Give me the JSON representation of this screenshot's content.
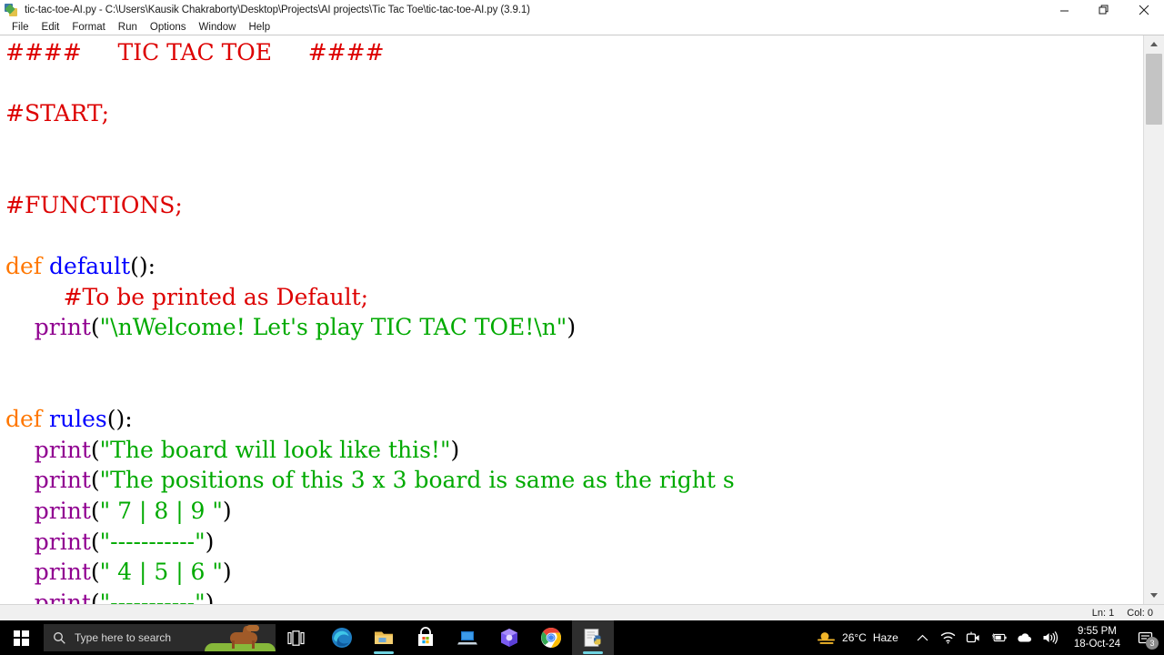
{
  "window": {
    "title": "tic-tac-toe-AI.py - C:\\Users\\Kausik Chakraborty\\Desktop\\Projects\\AI projects\\Tic Tac Toe\\tic-tac-toe-AI.py (3.9.1)",
    "icon": "python-idle-icon",
    "controls": {
      "minimize": "minimize-button",
      "restore": "restore-button",
      "close": "close-button"
    }
  },
  "menubar": {
    "items": [
      {
        "label": "File"
      },
      {
        "label": "Edit"
      },
      {
        "label": "Format"
      },
      {
        "label": "Run"
      },
      {
        "label": "Options"
      },
      {
        "label": "Window"
      },
      {
        "label": "Help"
      }
    ]
  },
  "editor": {
    "language": "python",
    "colors": {
      "comment": "#dd0000",
      "keyword": "#ff7700",
      "definition": "#0000ff",
      "builtin": "#900090",
      "string": "#00aa00",
      "plain": "#000000",
      "background": "#ffffff"
    },
    "lines": [
      {
        "n": 1,
        "tokens": [
          {
            "t": "comment",
            "s": "####     TIC TAC TOE     ####"
          }
        ]
      },
      {
        "n": 2,
        "tokens": []
      },
      {
        "n": 3,
        "tokens": [
          {
            "t": "comment",
            "s": "#START;"
          }
        ]
      },
      {
        "n": 4,
        "tokens": []
      },
      {
        "n": 5,
        "tokens": []
      },
      {
        "n": 6,
        "tokens": [
          {
            "t": "comment",
            "s": "#FUNCTIONS;"
          }
        ]
      },
      {
        "n": 7,
        "tokens": []
      },
      {
        "n": 8,
        "tokens": [
          {
            "t": "keyword",
            "s": "def"
          },
          {
            "t": "plain",
            "s": " "
          },
          {
            "t": "definition",
            "s": "default"
          },
          {
            "t": "plain",
            "s": "():"
          }
        ]
      },
      {
        "n": 9,
        "tokens": [
          {
            "t": "comment",
            "s": "        #To be printed as Default;"
          }
        ]
      },
      {
        "n": 10,
        "tokens": [
          {
            "t": "plain",
            "s": "    "
          },
          {
            "t": "builtin",
            "s": "print"
          },
          {
            "t": "plain",
            "s": "("
          },
          {
            "t": "string",
            "s": "\"\\nWelcome! Let's play TIC TAC TOE!\\n\""
          },
          {
            "t": "plain",
            "s": ")"
          }
        ]
      },
      {
        "n": 11,
        "tokens": []
      },
      {
        "n": 12,
        "tokens": []
      },
      {
        "n": 13,
        "tokens": [
          {
            "t": "keyword",
            "s": "def"
          },
          {
            "t": "plain",
            "s": " "
          },
          {
            "t": "definition",
            "s": "rules"
          },
          {
            "t": "plain",
            "s": "():"
          }
        ]
      },
      {
        "n": 14,
        "tokens": [
          {
            "t": "plain",
            "s": "    "
          },
          {
            "t": "builtin",
            "s": "print"
          },
          {
            "t": "plain",
            "s": "("
          },
          {
            "t": "string",
            "s": "\"The board will look like this!\""
          },
          {
            "t": "plain",
            "s": ")"
          }
        ]
      },
      {
        "n": 15,
        "tokens": [
          {
            "t": "plain",
            "s": "    "
          },
          {
            "t": "builtin",
            "s": "print"
          },
          {
            "t": "plain",
            "s": "("
          },
          {
            "t": "string",
            "s": "\"The positions of this 3 x 3 board is same as the right s"
          }
        ]
      },
      {
        "n": 16,
        "tokens": [
          {
            "t": "plain",
            "s": "    "
          },
          {
            "t": "builtin",
            "s": "print"
          },
          {
            "t": "plain",
            "s": "("
          },
          {
            "t": "string",
            "s": "\" 7 | 8 | 9 \""
          },
          {
            "t": "plain",
            "s": ")"
          }
        ]
      },
      {
        "n": 17,
        "tokens": [
          {
            "t": "plain",
            "s": "    "
          },
          {
            "t": "builtin",
            "s": "print"
          },
          {
            "t": "plain",
            "s": "("
          },
          {
            "t": "string",
            "s": "\"-----------\""
          },
          {
            "t": "plain",
            "s": ")"
          }
        ]
      },
      {
        "n": 18,
        "tokens": [
          {
            "t": "plain",
            "s": "    "
          },
          {
            "t": "builtin",
            "s": "print"
          },
          {
            "t": "plain",
            "s": "("
          },
          {
            "t": "string",
            "s": "\" 4 | 5 | 6 \""
          },
          {
            "t": "plain",
            "s": ")"
          }
        ]
      },
      {
        "n": 19,
        "tokens": [
          {
            "t": "plain",
            "s": "    "
          },
          {
            "t": "builtin",
            "s": "print"
          },
          {
            "t": "plain",
            "s": "("
          },
          {
            "t": "string",
            "s": "\"-----------\""
          },
          {
            "t": "plain",
            "s": ")"
          }
        ]
      }
    ],
    "scrollbar": {
      "vertical": "visible",
      "horizontal": "visible"
    }
  },
  "statusbar": {
    "line": "Ln: 1",
    "col": "Col: 0"
  },
  "taskbar": {
    "start": "windows-start-button",
    "search": {
      "placeholder": "Type here to search"
    },
    "taskview": "task-view-button",
    "apps": [
      {
        "name": "microsoft-edge",
        "running": false
      },
      {
        "name": "file-explorer",
        "running": true
      },
      {
        "name": "microsoft-store",
        "running": false
      },
      {
        "name": "remote-desktop",
        "running": false
      },
      {
        "name": "microsoft-365",
        "running": false
      },
      {
        "name": "google-chrome",
        "running": true
      },
      {
        "name": "python-idle",
        "running": true,
        "active": true
      }
    ],
    "weather": {
      "temperature": "26°C",
      "condition": "Haze"
    },
    "tray": [
      "show-hidden-icons",
      "wifi",
      "camera",
      "battery",
      "onedrive",
      "volume"
    ],
    "clock": {
      "time": "9:55 PM",
      "date": "18-Oct-24"
    },
    "notifications": {
      "count": "3"
    }
  }
}
